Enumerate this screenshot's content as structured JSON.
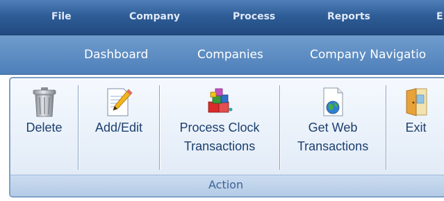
{
  "menubar": {
    "items": [
      {
        "label": "File"
      },
      {
        "label": "Company"
      },
      {
        "label": "Process"
      },
      {
        "label": "Reports"
      },
      {
        "label": "E"
      }
    ]
  },
  "navbar": {
    "items": [
      {
        "label": "Dashboard"
      },
      {
        "label": "Companies"
      },
      {
        "label": "Company Navigatio"
      }
    ]
  },
  "ribbon": {
    "group_label": "Action",
    "buttons": [
      {
        "label_line1": "Delete",
        "label_line2": "",
        "icon": "trash-icon"
      },
      {
        "label_line1": "Add/Edit",
        "label_line2": "",
        "icon": "edit-document-icon"
      },
      {
        "label_line1": "Process Clock",
        "label_line2": "Transactions",
        "icon": "process-blocks-icon"
      },
      {
        "label_line1": "Get Web",
        "label_line2": "Transactions",
        "icon": "web-document-icon"
      },
      {
        "label_line1": "Exit",
        "label_line2": "",
        "icon": "exit-door-icon"
      }
    ]
  },
  "colors": {
    "menubar": "#2f5d97",
    "navbar": "#5a89c2",
    "ribbon_text": "#1c3f6e",
    "ribbon_border": "#7ea0c7"
  }
}
